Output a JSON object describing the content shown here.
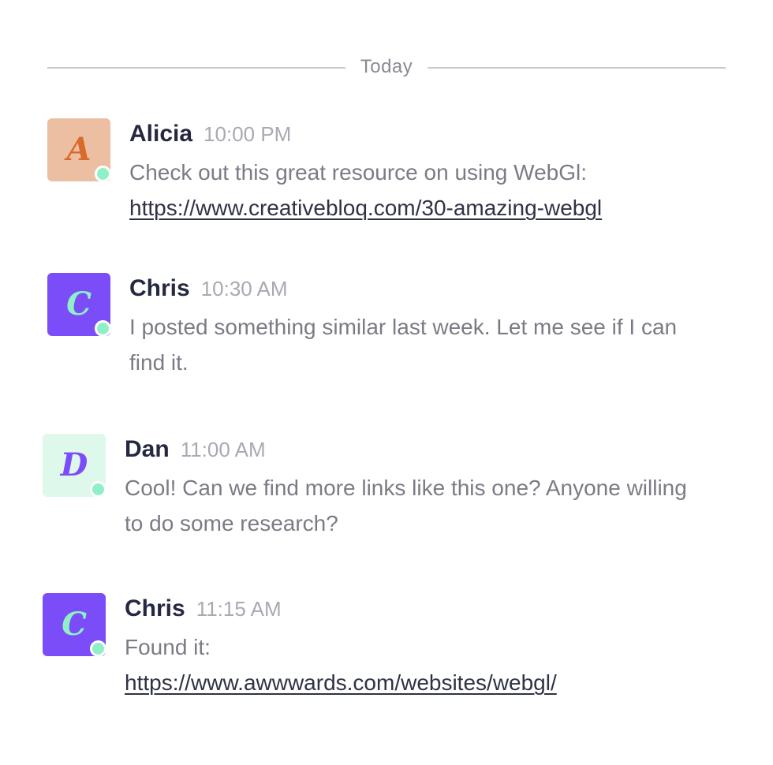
{
  "divider": {
    "label": "Today"
  },
  "colors": {
    "status_online": "#8ff0c7",
    "name_text": "#252840",
    "message_text": "#7b7b86",
    "time_text": "#a8a9b3"
  },
  "messages": [
    {
      "author": "Alicia",
      "initial": "A",
      "time": "10:00 PM",
      "text": "Check out this great resource on using WebGl:",
      "link": "https://www.creativebloq.com/30-amazing-webgl",
      "avatar_bg": "#ecbfa3",
      "avatar_fg": "#d86a2c",
      "status": "online"
    },
    {
      "author": "Chris",
      "initial": "C",
      "time": "10:30 AM",
      "text": "I posted something similar last week. Let me see if I can find it.",
      "avatar_bg": "#7b4df8",
      "avatar_fg": "#8ff0c7",
      "status": "online"
    },
    {
      "author": "Dan",
      "initial": "D",
      "time": "11:00 AM",
      "text": "Cool! Can we find more links like this one? Anyone willing to do some research?",
      "avatar_bg": "#dff8ec",
      "avatar_fg": "#7b4df8",
      "status": "online"
    },
    {
      "author": "Chris",
      "initial": "C",
      "time": "11:15 AM",
      "text": "Found it:",
      "link": "https://www.awwwards.com/websites/webgl/",
      "avatar_bg": "#7b4df8",
      "avatar_fg": "#8ff0c7",
      "status": "online"
    }
  ]
}
